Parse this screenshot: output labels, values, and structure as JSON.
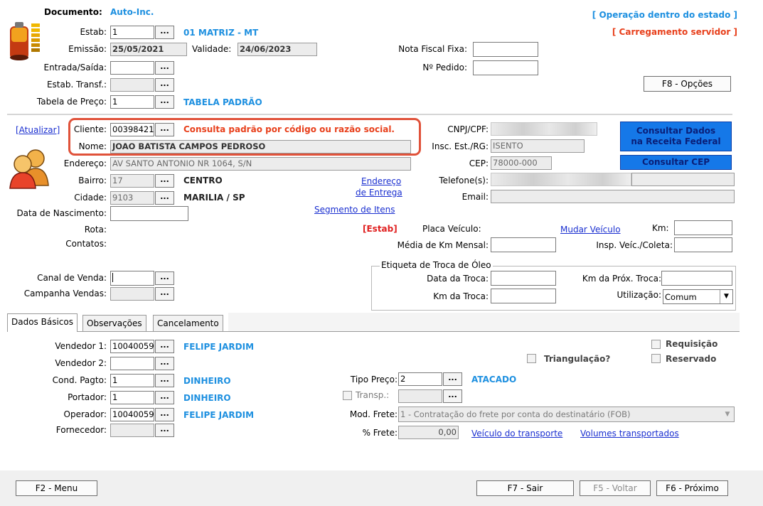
{
  "header": {
    "documento_label": "Documento:",
    "documento_value": "Auto-Inc.",
    "op_status": "[ Operação dentro do estado ]",
    "load_status": "[ Carregamento servidor ]",
    "estab_label": "Estab:",
    "estab_value": "1",
    "estab_name": "01 MATRIZ - MT",
    "emissao_label": "Emissão:",
    "emissao_value": "25/05/2021",
    "validade_label": "Validade:",
    "validade_value": "24/06/2023",
    "entrada_label": "Entrada/Saída:",
    "estab_transf_label": "Estab. Transf.:",
    "tabela_label": "Tabela de Preço:",
    "tabela_value": "1",
    "tabela_name": "TABELA PADRÃO",
    "nf_fixa_label": "Nota Fiscal Fixa:",
    "pedido_label": "Nº Pedido:",
    "options_button": "F8 - Opções",
    "dots": "..."
  },
  "cliente": {
    "atualizar_link": "[Atualizar]",
    "cliente_label": "Cliente:",
    "cliente_value": "00398421",
    "hint": "Consulta padrão por código ou razão social.",
    "nome_label": "Nome:",
    "nome_value": "JOAO BATISTA CAMPOS PEDROSO",
    "endereco_label": "Endereço:",
    "endereco_value": "AV SANTO ANTONIO NR 1064, S/N",
    "bairro_label": "Bairro:",
    "bairro_value": "17",
    "bairro_name": "CENTRO",
    "cidade_label": "Cidade:",
    "cidade_value": "9103",
    "cidade_name": "MARILIA / SP",
    "nascimento_label": "Data de Nascimento:",
    "rota_label": "Rota:",
    "contatos_label": "Contatos:",
    "endereco_entrega_link_1": "Endereço",
    "endereco_entrega_link_2": "de Entrega",
    "segmento_link": "Segmento de Itens",
    "estab_tag": "[Estab]",
    "cnpj_label": "CNPJ/CPF:",
    "insc_label": "Insc. Est./RG:",
    "insc_value": "ISENTO",
    "cep_label": "CEP:",
    "cep_value": "78000-000",
    "telefone_label": "Telefone(s):",
    "email_label": "Email:",
    "consultar_receita_1": "Consultar Dados",
    "consultar_receita_2": "na Receita Federal",
    "consultar_cep": "Consultar CEP",
    "placa_label": "Placa Veículo:",
    "mudar_veiculo_link": "Mudar Veículo",
    "km_label": "Km:",
    "media_km_label": "Média de Km Mensal:",
    "insp_label": "Insp. Veíc./Coleta:",
    "canal_label": "Canal de Venda:",
    "campanha_label": "Campanha Vendas:"
  },
  "oleo": {
    "group_title": "Etiqueta de Troca de Óleo",
    "data_troca_label": "Data da Troca:",
    "km_troca_label": "Km da Troca:",
    "km_prox_label": "Km da Próx. Troca:",
    "utilizacao_label": "Utilização:",
    "utilizacao_value": "Comum"
  },
  "tabs": [
    {
      "label": "Dados Básicos"
    },
    {
      "label": "Observações"
    },
    {
      "label": "Cancelamento"
    }
  ],
  "dados": {
    "vendedor1_label": "Vendedor 1:",
    "vendedor1_value": "10040059",
    "vendedor1_name": "FELIPE JARDIM",
    "vendedor2_label": "Vendedor 2:",
    "cond_label": "Cond. Pagto:",
    "cond_value": "1",
    "cond_name": "DINHEIRO",
    "portador_label": "Portador:",
    "portador_value": "1",
    "portador_name": "DINHEIRO",
    "operador_label": "Operador:",
    "operador_value": "10040059",
    "operador_name": "FELIPE JARDIM",
    "fornecedor_label": "Fornecedor:",
    "requisicao_label": "Requisição",
    "triangulacao_label": "Triangulação?",
    "reservado_label": "Reservado",
    "tipo_preco_label": "Tipo Preço:",
    "tipo_preco_value": "2",
    "tipo_preco_name": "ATACADO",
    "transp_label": "Transp.:",
    "mod_frete_label": "Mod. Frete:",
    "mod_frete_value": "1 - Contratação do frete por conta do destinatário (FOB)",
    "frete_label": "% Frete:",
    "frete_value": "0,00",
    "veiculo_link": "Veículo do transporte",
    "volumes_link": "Volumes transportados"
  },
  "footer": {
    "menu_button": "F2 - Menu",
    "sair_button": "F7 - Sair",
    "voltar_button": "F5 - Voltar",
    "proximo_button": "F6 - Próximo"
  },
  "colors": {
    "accent_blue": "#1e90e0",
    "alert_red": "#e8401c",
    "link_blue": "#1a2fd0",
    "consult_button": "#1578e8"
  }
}
